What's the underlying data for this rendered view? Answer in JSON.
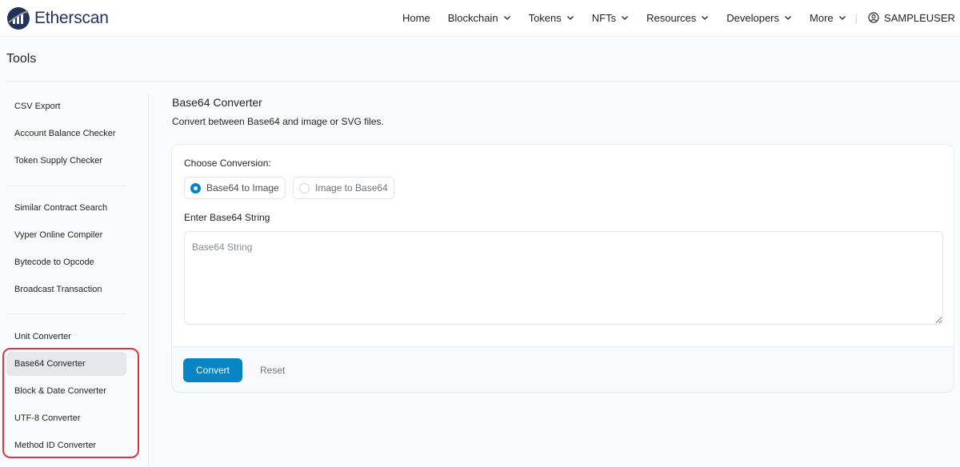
{
  "header": {
    "logo_text": "Etherscan",
    "nav": [
      {
        "label": "Home",
        "has_dropdown": false
      },
      {
        "label": "Blockchain",
        "has_dropdown": true
      },
      {
        "label": "Tokens",
        "has_dropdown": true
      },
      {
        "label": "NFTs",
        "has_dropdown": true
      },
      {
        "label": "Resources",
        "has_dropdown": true
      },
      {
        "label": "Developers",
        "has_dropdown": true
      },
      {
        "label": "More",
        "has_dropdown": true
      }
    ],
    "separator": "|",
    "user": "SAMPLEUSER"
  },
  "page": {
    "title": "Tools"
  },
  "sidebar": {
    "groups": [
      [
        "CSV Export",
        "Account Balance Checker",
        "Token Supply Checker"
      ],
      [
        "Similar Contract Search",
        "Vyper Online Compiler",
        "Bytecode to Opcode",
        "Broadcast Transaction"
      ],
      [
        "Unit Converter",
        "Base64 Converter",
        "Block & Date Converter",
        "UTF-8 Converter",
        "Method ID Converter"
      ]
    ],
    "active": "Base64 Converter"
  },
  "content": {
    "heading": "Base64 Converter",
    "subtitle": "Convert between Base64 and image or SVG files.",
    "choose_label": "Choose Conversion:",
    "options": [
      {
        "label": "Base64 to Image",
        "selected": true
      },
      {
        "label": "Image to Base64",
        "selected": false
      }
    ],
    "input_label": "Enter Base64 String",
    "input_placeholder": "Base64 String",
    "input_value": "",
    "convert_label": "Convert",
    "reset_label": "Reset"
  },
  "colors": {
    "accent": "#0784c3",
    "brand_dark": "#21325b",
    "highlight": "#d9363e"
  }
}
